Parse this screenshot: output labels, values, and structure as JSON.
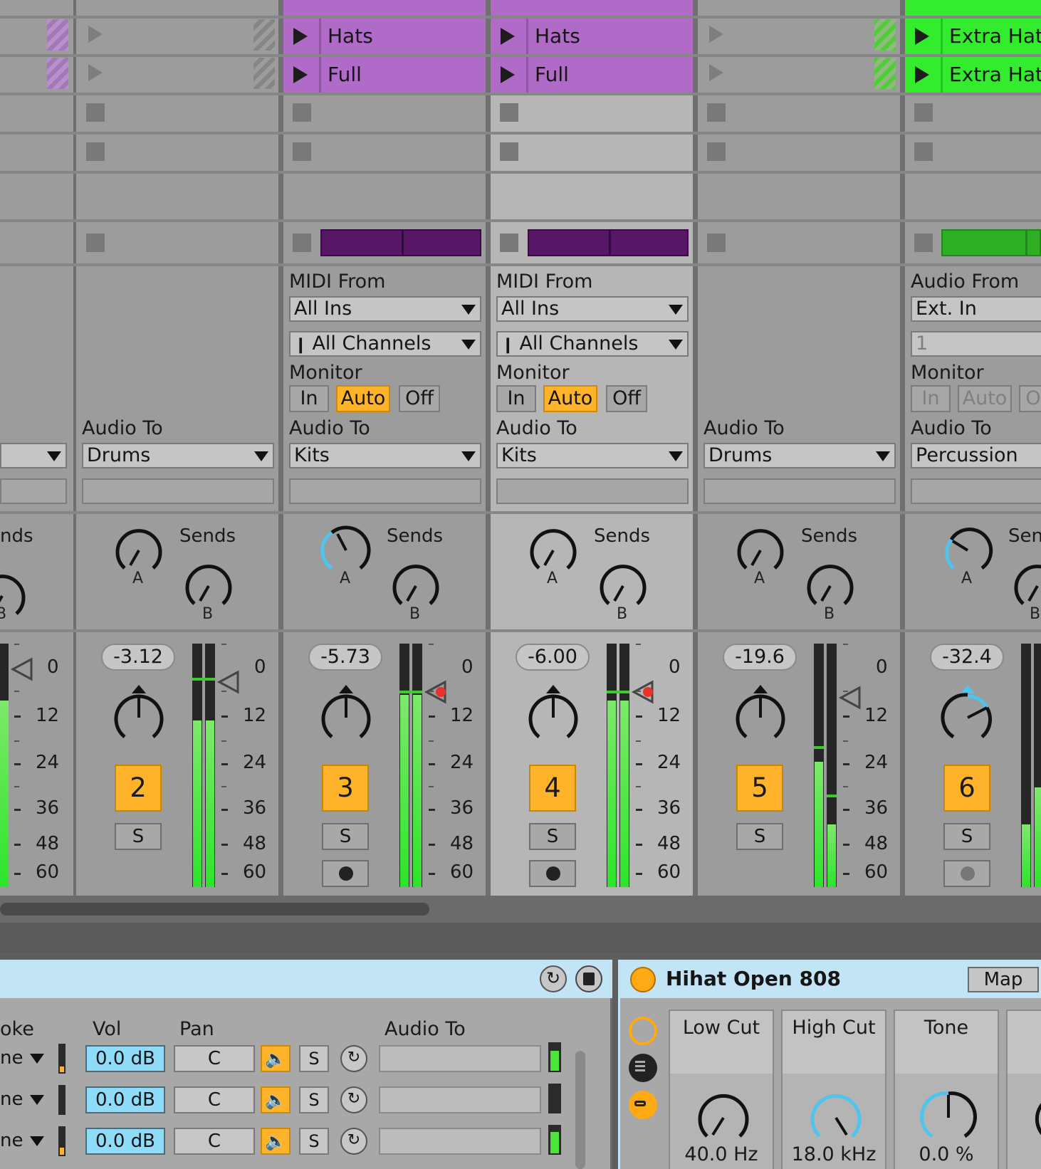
{
  "clips": {
    "row1": [
      "Hats",
      "Hats",
      "Extra Hat"
    ],
    "row2": [
      "Full",
      "Full",
      "Extra Hat"
    ]
  },
  "tracks": [
    {
      "id": "t1",
      "sends_label": "nds",
      "knob_b": "B",
      "volume": "",
      "scale": [
        "0",
        "12",
        "24",
        "36",
        "48",
        "60"
      ]
    },
    {
      "id": "t2",
      "audio_to_label": "Audio To",
      "audio_to": "Drums",
      "sends_label": "Sends",
      "knob_a": "A",
      "knob_b": "B",
      "volume": "-3.12",
      "number": "2",
      "solo": "S",
      "scale": [
        "0",
        "12",
        "24",
        "36",
        "48",
        "60"
      ]
    },
    {
      "id": "t3",
      "midi_from_label": "MIDI From",
      "midi_from": "All Ins",
      "channel": "All Channels",
      "monitor_label": "Monitor",
      "monitor": [
        "In",
        "Auto",
        "Off"
      ],
      "audio_to_label": "Audio To",
      "audio_to": "Kits",
      "sends_label": "Sends",
      "knob_a": "A",
      "knob_b": "B",
      "volume": "-5.73",
      "number": "3",
      "solo": "S",
      "scale": [
        "0",
        "12",
        "24",
        "36",
        "48",
        "60"
      ]
    },
    {
      "id": "t4",
      "midi_from_label": "MIDI From",
      "midi_from": "All Ins",
      "channel": "All Channels",
      "monitor_label": "Monitor",
      "monitor": [
        "In",
        "Auto",
        "Off"
      ],
      "audio_to_label": "Audio To",
      "audio_to": "Kits",
      "sends_label": "Sends",
      "knob_a": "A",
      "knob_b": "B",
      "volume": "-6.00",
      "number": "4",
      "solo": "S",
      "scale": [
        "0",
        "12",
        "24",
        "36",
        "48",
        "60"
      ]
    },
    {
      "id": "t5",
      "audio_to_label": "Audio To",
      "audio_to": "Drums",
      "sends_label": "Sends",
      "knob_a": "A",
      "knob_b": "B",
      "volume": "-19.6",
      "number": "5",
      "solo": "S",
      "scale": [
        "0",
        "12",
        "24",
        "36",
        "48",
        "60"
      ]
    },
    {
      "id": "t6",
      "audio_from_label": "Audio From",
      "audio_from": "Ext. In",
      "input_channel": "1",
      "monitor_label": "Monitor",
      "monitor": [
        "In",
        "Auto",
        "O"
      ],
      "audio_to_label": "Audio To",
      "audio_to": "Percussion",
      "sends_label": "Sen",
      "knob_a": "A",
      "knob_b": "B",
      "volume": "-32.4",
      "number": "6",
      "solo": "S"
    }
  ],
  "chain": {
    "headers": [
      "oke",
      "Vol",
      "Pan",
      "Audio To"
    ],
    "rows": [
      {
        "zone": "ne",
        "vol": "0.0 dB",
        "pan": "C",
        "solo": "S"
      },
      {
        "zone": "ne",
        "vol": "0.0 dB",
        "pan": "C",
        "solo": "S"
      },
      {
        "zone": "ne",
        "vol": "0.0 dB",
        "pan": "C",
        "solo": "S"
      }
    ]
  },
  "device": {
    "title": "Hihat Open 808",
    "map": "Map",
    "macros": [
      {
        "label": "Low Cut",
        "value": "40.0 Hz"
      },
      {
        "label": "High Cut",
        "value": "18.0 kHz"
      },
      {
        "label": "Tone",
        "value": "0.0 %"
      }
    ]
  },
  "colors": {
    "midi_clip": "#b06ac7",
    "audio_clip": "#33ec2e",
    "track_number": "#ffb32a",
    "header_bg": "#c3e4f5",
    "vol_field": "#8fdcf9"
  }
}
